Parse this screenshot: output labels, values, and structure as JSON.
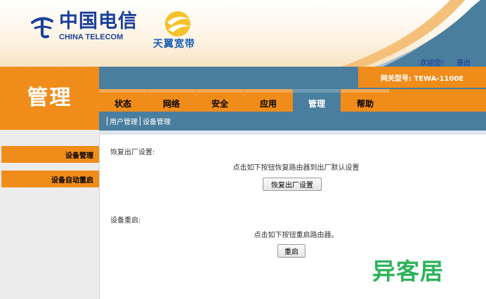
{
  "header": {
    "brand_cn": "中国电信",
    "brand_en": "CHINA TELECOM",
    "sub_brand": "天翼宽带",
    "welcome_link": "欢迎您!",
    "logout_link": "退出"
  },
  "page_title": "管理",
  "model": "网关型号: TEWA-1100E",
  "tabs": [
    {
      "label": "状态"
    },
    {
      "label": "网络"
    },
    {
      "label": "安全"
    },
    {
      "label": "应用"
    },
    {
      "label": "管理",
      "active": true
    },
    {
      "label": "帮助"
    }
  ],
  "subnav": {
    "items": [
      "用户管理",
      "设备管理"
    ]
  },
  "sidebar": {
    "items": [
      "设备管理",
      "设备自动重启"
    ]
  },
  "sections": {
    "restore": {
      "title": "恢复出厂设置:",
      "description": "点击如下按钮恢复路由器到出厂默认设置",
      "button": "恢复出厂设置"
    },
    "reboot": {
      "title": "设备重启:",
      "description": "点击如下按钮重启路由器。",
      "button": "重启"
    }
  },
  "watermark": "异客居",
  "colors": {
    "orange": "#f08c1a",
    "blue": "#4a7e9e",
    "brand_blue": "#1a3f9c",
    "watermark_green": "#2db35a"
  }
}
